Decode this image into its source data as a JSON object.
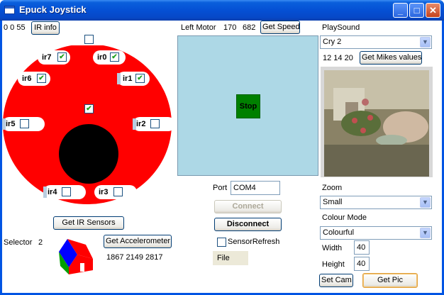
{
  "window": {
    "title": "Epuck Joystick",
    "minimize_glyph": "_",
    "maximize_glyph": "□",
    "close_glyph": "✕"
  },
  "left": {
    "ir_readout": "0 0 55",
    "ir_info_button": "IR info",
    "sensors": {
      "ir0": "ir0",
      "ir1": "ir1",
      "ir2": "ir2",
      "ir3": "ir3",
      "ir4": "ir4",
      "ir5": "ir5",
      "ir6": "ir6",
      "ir7": "ir7"
    },
    "sensor_checked": {
      "ir0": true,
      "ir1": true,
      "ir2": false,
      "ir3": false,
      "ir4": false,
      "ir5": false,
      "ir6": true,
      "ir7": true
    },
    "center_checked": true,
    "get_ir_sensors_button": "Get IR Sensors",
    "selector_label": "Selector",
    "selector_value": "2",
    "get_accelerometer_button": "Get Accelerometer",
    "accelerometer_values": "1867 2149 2817",
    "colors": {
      "robot_body": "#ff0000",
      "robot_center": "#000000"
    }
  },
  "middle": {
    "left_motor_label": "Left Motor",
    "left_motor_value1": "170",
    "left_motor_value2": "682",
    "get_speed_button": "Get Speed",
    "stop_button": "Stop",
    "port_label": "Port",
    "port_value": "COM4",
    "connect_button": "Connect",
    "disconnect_button": "Disconnect",
    "sensor_refresh_label": "SensorRefresh",
    "sensor_refresh_checked": false,
    "file_menu": "File",
    "colors": {
      "pad": "#add8e6",
      "stop": "#008000"
    }
  },
  "right": {
    "playsound_label": "PlaySound",
    "playsound_value": "Cry 2",
    "mikes_values": "12 14 20",
    "get_mikes_button": "Get Mikes values",
    "zoom_label": "Zoom",
    "zoom_value": "Small",
    "colour_mode_label": "Colour Mode",
    "colour_mode_value": "Colourful",
    "width_label": "Width",
    "width_value": "40",
    "height_label": "Height",
    "height_value": "40",
    "set_cam_button": "Set Cam",
    "get_pic_button": "Get Pic"
  },
  "icons": {
    "dropdown": "▼",
    "check": "check-icon"
  }
}
